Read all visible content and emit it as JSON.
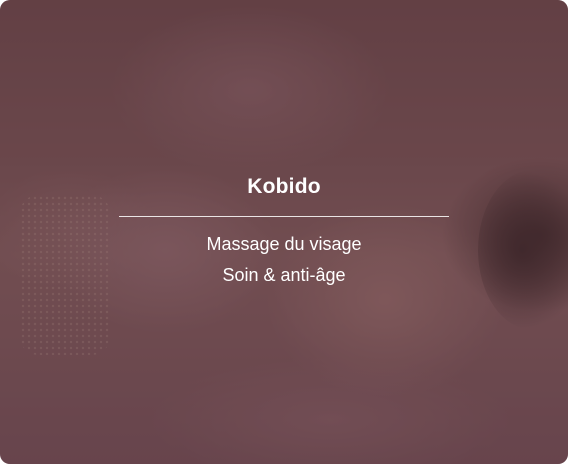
{
  "card": {
    "title": "Kobido",
    "lines": [
      "Massage du visage",
      "Soin & anti-âge"
    ]
  },
  "colors": {
    "overlay": "#55323c",
    "text": "#ffffff"
  }
}
